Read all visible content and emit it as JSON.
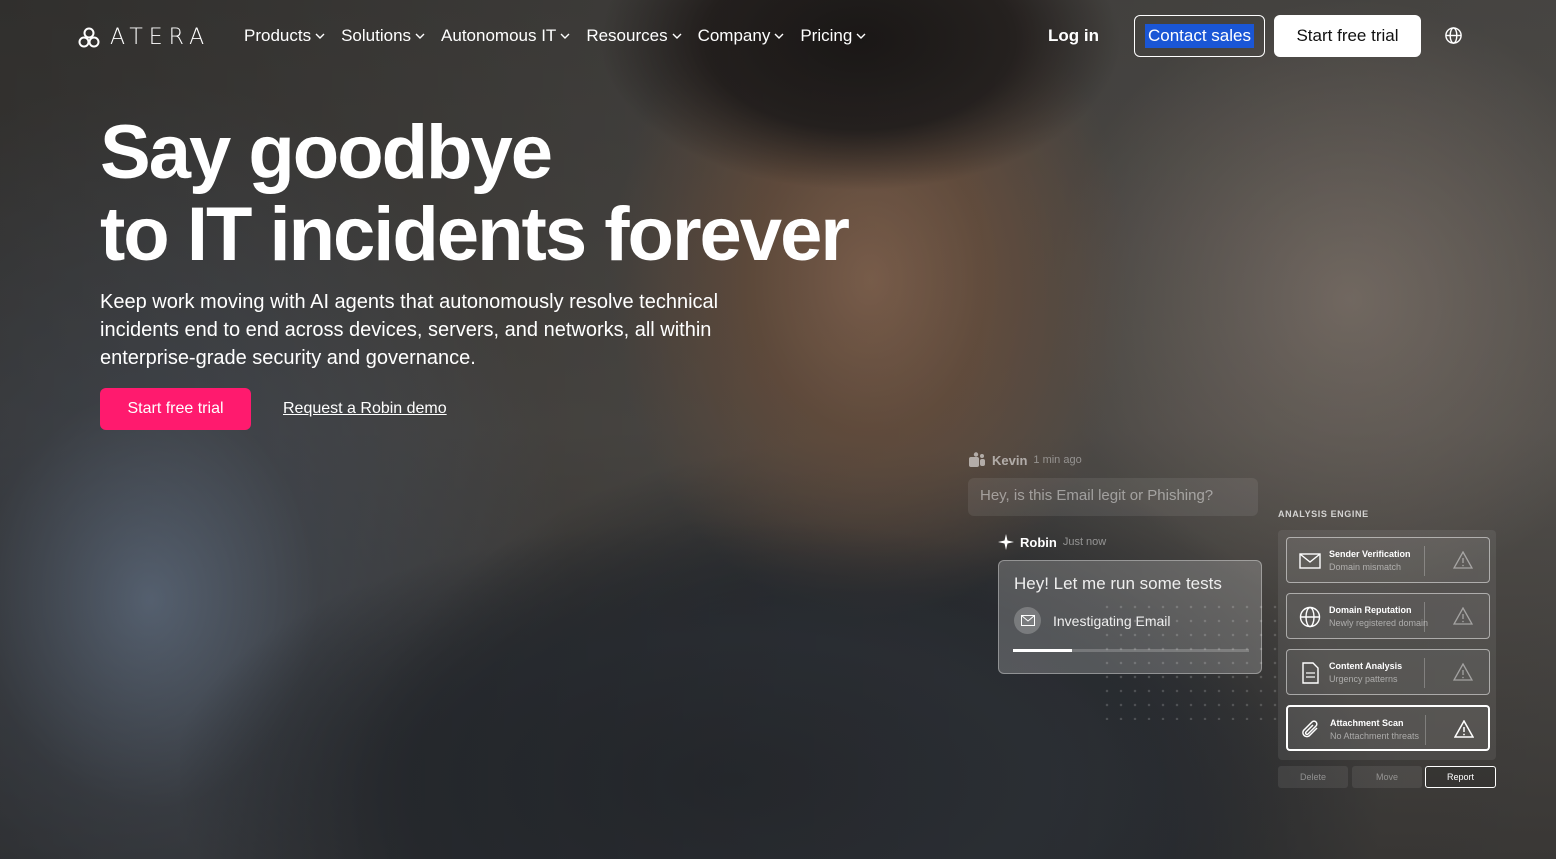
{
  "brand": {
    "name": "ATERA"
  },
  "nav": {
    "items": [
      {
        "label": "Products"
      },
      {
        "label": "Solutions"
      },
      {
        "label": "Autonomous IT"
      },
      {
        "label": "Resources"
      },
      {
        "label": "Company"
      },
      {
        "label": "Pricing"
      }
    ],
    "login": "Log in",
    "contact": "Contact sales",
    "trial": "Start free trial"
  },
  "hero": {
    "title_line1": "Say goodbye",
    "title_line2": "to IT incidents forever",
    "subtitle": "Keep work moving with AI agents that autonomously resolve technical incidents end to end across devices, servers, and networks, all within enterprise-grade security and governance.",
    "cta_primary": "Start free trial",
    "cta_secondary": "Request a Robin demo"
  },
  "chat": {
    "kevin": {
      "name": "Kevin",
      "time": "1 min ago",
      "message": "Hey, is this Email legit or Phishing?"
    },
    "robin": {
      "name": "Robin",
      "time": "Just now",
      "message": "Hey! Let me run some tests",
      "status": "Investigating Email",
      "progress": 0.25
    }
  },
  "analysis": {
    "title": "ANALYSIS ENGINE",
    "checks": [
      {
        "name": "Sender Verification",
        "desc": "Domain mismatch",
        "icon": "mail-icon"
      },
      {
        "name": "Domain Reputation",
        "desc": "Newly registered domain",
        "icon": "globe-icon"
      },
      {
        "name": "Content Analysis",
        "desc": "Urgency patterns",
        "icon": "document-icon"
      },
      {
        "name": "Attachment Scan",
        "desc": "No Attachment threats",
        "icon": "paperclip-icon"
      }
    ],
    "actions": {
      "delete": "Delete",
      "move": "Move",
      "report": "Report"
    }
  },
  "colors": {
    "accent": "#ff1a6e",
    "contact_highlight": "#1a56d6"
  }
}
